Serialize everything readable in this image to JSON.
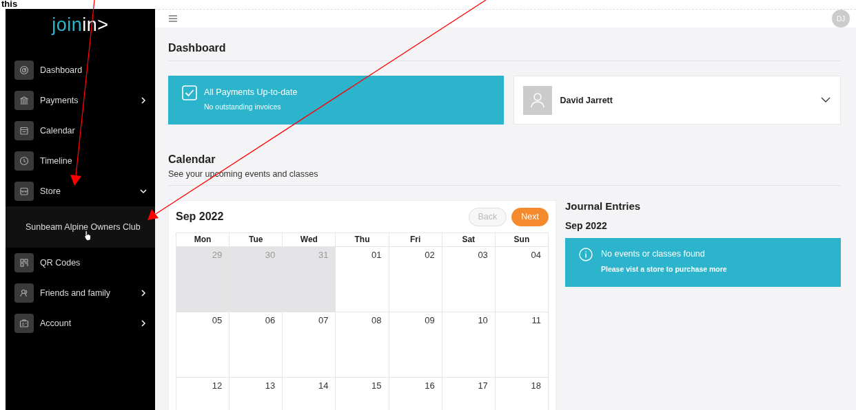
{
  "annotation": {
    "text": "this"
  },
  "sidebar": {
    "logo": {
      "accent": "join",
      "rest": "in>"
    },
    "items": [
      {
        "label": "Dashboard"
      },
      {
        "label": "Payments",
        "expanded": false
      },
      {
        "label": "Calendar"
      },
      {
        "label": "Timeline"
      },
      {
        "label": "Store",
        "expanded": true,
        "children": [
          {
            "label": "Sunbeam Alpine Owners Club",
            "hovered": true
          }
        ]
      },
      {
        "label": "QR Codes"
      },
      {
        "label": "Friends and family",
        "expanded": false
      },
      {
        "label": "Account",
        "expanded": false
      }
    ]
  },
  "header": {
    "avatar": "DJ"
  },
  "dashboard": {
    "title": "Dashboard",
    "payment_status": {
      "title": "All Payments Up-to-date",
      "subtitle": "No outstanding invoices",
      "checked": true
    },
    "member": {
      "name": "David Jarrett",
      "expanded": false
    }
  },
  "calendar_section": {
    "title": "Calendar",
    "subtitle": "See your upcoming events and classes"
  },
  "calendar": {
    "month": "Sep 2022",
    "back": {
      "label": "Back",
      "disabled": true
    },
    "next": {
      "label": "Next",
      "disabled": false
    },
    "weekdays": [
      "Mon",
      "Tue",
      "Wed",
      "Thu",
      "Fri",
      "Sat",
      "Sun"
    ],
    "weeks": [
      [
        {
          "day": "29",
          "outside": true
        },
        {
          "day": "30",
          "outside": true
        },
        {
          "day": "31",
          "outside": true
        },
        {
          "day": "01",
          "outside": false
        },
        {
          "day": "02",
          "outside": false
        },
        {
          "day": "03",
          "outside": false
        },
        {
          "day": "04",
          "outside": false
        }
      ],
      [
        {
          "day": "05",
          "outside": false
        },
        {
          "day": "06",
          "outside": false
        },
        {
          "day": "07",
          "outside": false
        },
        {
          "day": "08",
          "outside": false
        },
        {
          "day": "09",
          "outside": false
        },
        {
          "day": "10",
          "outside": false
        },
        {
          "day": "11",
          "outside": false
        }
      ],
      [
        {
          "day": "12",
          "outside": false
        },
        {
          "day": "13",
          "outside": false
        },
        {
          "day": "14",
          "outside": false
        },
        {
          "day": "15",
          "outside": false
        },
        {
          "day": "16",
          "outside": false
        },
        {
          "day": "17",
          "outside": false
        },
        {
          "day": "18",
          "outside": false
        }
      ]
    ]
  },
  "journal": {
    "title": "Journal Entries",
    "month": "Sep 2022",
    "notice": {
      "title": "No events or classes found",
      "message": "Please vist a store to purchase more"
    }
  }
}
